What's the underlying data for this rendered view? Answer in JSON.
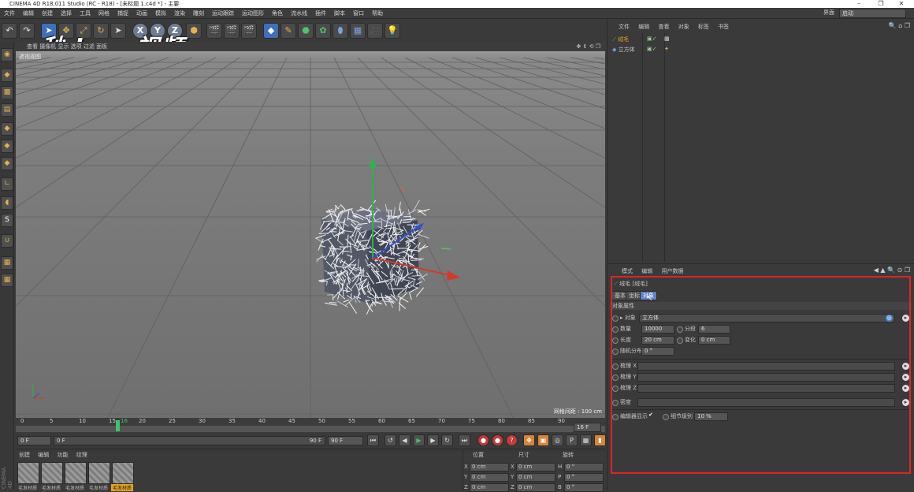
{
  "window": {
    "title": "CINEMA 4D R18.011 Studio (RC - R18) - [未标题 1.c4d *] - 主要",
    "min": "–",
    "max": "❐",
    "close": "✕"
  },
  "menubar": {
    "items": [
      "文件",
      "编辑",
      "创建",
      "选择",
      "工具",
      "网格",
      "捕捉",
      "动画",
      "模拟",
      "渲染",
      "雕刻",
      "运动跟踪",
      "运动图形",
      "角色",
      "流水线",
      "插件",
      "脚本",
      "窗口",
      "帮助"
    ],
    "layout_label": "界面",
    "layout_value": "启动"
  },
  "watermark": "秒dong视频",
  "viewport": {
    "header": "查看 摄像机 显示 选项 过滤 面板",
    "label": "透视视图",
    "grid_info": "网格间距 : 100 cm"
  },
  "timeline": {
    "ticks": [
      "0",
      "5",
      "10",
      "15",
      "16",
      "20",
      "25",
      "30",
      "35",
      "40",
      "45",
      "50",
      "55",
      "60",
      "65",
      "70",
      "75",
      "80",
      "85",
      "90"
    ],
    "current_frame": "16 F",
    "start_field": "0 F",
    "range_start": "0 F",
    "range_end": "90 F",
    "end_field": "90 F"
  },
  "material_manager": {
    "menu": [
      "创建",
      "编辑",
      "功能",
      "纹理"
    ],
    "materials": [
      "毛发材质",
      "毛发材质",
      "毛发材质",
      "毛发材质",
      "毛发材质"
    ]
  },
  "coordinates": {
    "headers": [
      "位置",
      "尺寸",
      "旋转"
    ],
    "rows": [
      {
        "axis": "X",
        "pos": "0 cm",
        "size_axis": "X",
        "size": "0 cm",
        "rot_axis": "H",
        "rot": "0 °"
      },
      {
        "axis": "Y",
        "pos": "0 cm",
        "size_axis": "Y",
        "size": "0 cm",
        "rot_axis": "P",
        "rot": "0 °"
      },
      {
        "axis": "Z",
        "pos": "0 cm",
        "size_axis": "Z",
        "size": "0 cm",
        "rot_axis": "B",
        "rot": "0 °"
      }
    ]
  },
  "object_manager": {
    "menu": [
      "文件",
      "编辑",
      "查看",
      "对象",
      "标签",
      "书签"
    ],
    "objects": [
      {
        "name": "绒毛",
        "color": "#e5a31a"
      },
      {
        "name": "立方体",
        "color": "#c8c8c8"
      }
    ]
  },
  "attribute_manager": {
    "menu": [
      "模式",
      "编辑",
      "用户数据"
    ],
    "object_title": "绒毛 [绒毛]",
    "tabs": [
      "基本",
      "坐标",
      "对象"
    ],
    "section": "对象属性",
    "fields": {
      "object_label": "对象",
      "object_value": "立方体",
      "count_label": "数量",
      "count_value": "10000",
      "segments_label": "分段",
      "segments_value": "6",
      "length_label": "长度",
      "length_value": "20 cm",
      "variation_label": "变化",
      "variation_value": "0 cm",
      "random_label": "随机分布",
      "random_value": "0 °",
      "comb_x": "梳理 X",
      "comb_y": "梳理 Y",
      "comb_z": "梳理 Z",
      "density": "密度",
      "editor_display": "编辑器显示",
      "editor_check": "✔",
      "detail_label": "细节级别",
      "detail_value": "10 %"
    }
  },
  "colors": {
    "accent": "#e5a31a",
    "highlight_frame": "#e02424",
    "selected_tab": "#5d82c6",
    "playhead": "#3ec46b"
  }
}
